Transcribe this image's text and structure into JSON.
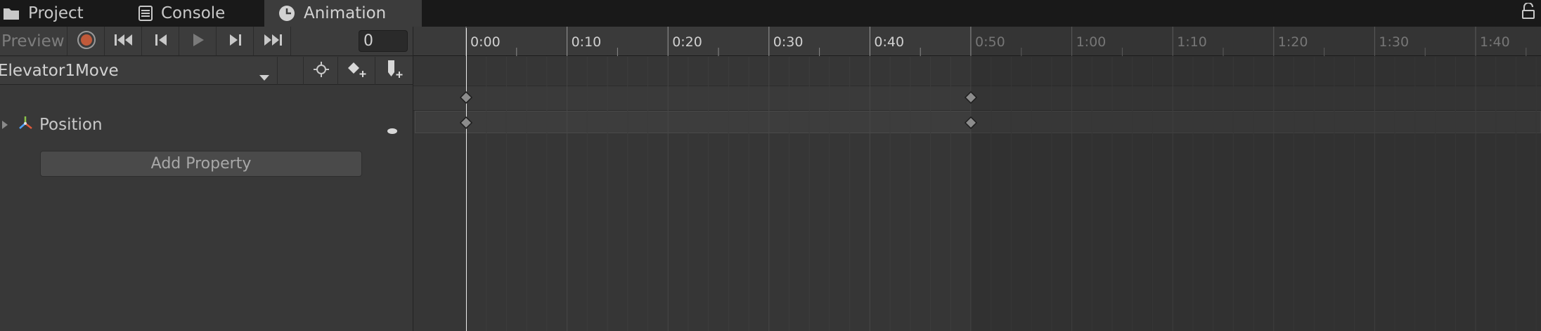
{
  "tabs": [
    {
      "label": "Project",
      "icon": "folder-icon",
      "active": false
    },
    {
      "label": "Console",
      "icon": "console-icon",
      "active": false
    },
    {
      "label": "Animation",
      "icon": "clock-icon",
      "active": true
    }
  ],
  "toolbar": {
    "preview_label": "Preview",
    "frame_value": "0",
    "buttons": [
      "record-icon",
      "first-key-icon",
      "prev-key-icon",
      "play-icon",
      "next-key-icon",
      "last-key-icon"
    ]
  },
  "clip": {
    "name": "Elevator1Move",
    "buttons": [
      "filter-by-selection-icon",
      "add-keyframe-icon",
      "add-event-icon"
    ]
  },
  "properties": {
    "items": [
      {
        "label": "Position",
        "icon": "transform-axes-icon"
      }
    ],
    "add_property_label": "Add Property"
  },
  "timeline": {
    "ticks": [
      "0:00",
      "0:10",
      "0:20",
      "0:30",
      "0:40",
      "0:50",
      "1:00",
      "1:10",
      "1:20",
      "1:30",
      "1:40"
    ],
    "keyframe_times": [
      "0:00",
      "0:50"
    ],
    "playhead_time": "0:00",
    "clip_end_time": "0:50"
  },
  "colors": {
    "record": "#c15a3a",
    "keyframe_fill": "#8c8c8c",
    "tab_active_bg": "#3c3c3c"
  }
}
